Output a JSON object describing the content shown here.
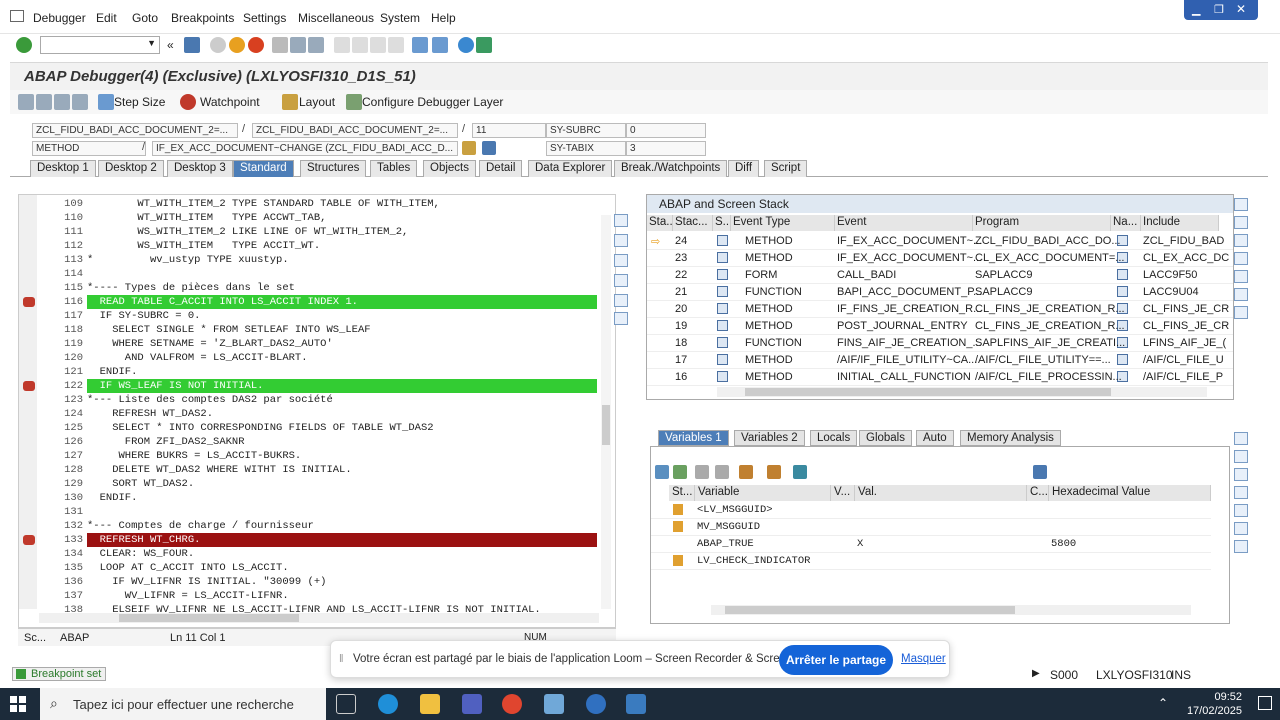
{
  "menubar": {
    "items": [
      "Debugger",
      "Edit",
      "Goto",
      "Breakpoints",
      "Settings",
      "Miscellaneous",
      "System",
      "Help"
    ]
  },
  "window": {
    "title": "ABAP Debugger(4)  (Exclusive) (LXLYOSFI310_D1S_51)"
  },
  "app_toolbar": {
    "step_size": "Step Size",
    "watchpoint": "Watchpoint",
    "layout": "Layout",
    "configure_layer": "Configure Debugger Layer"
  },
  "fields": {
    "program": "ZCL_FIDU_BADI_ACC_DOCUMENT_2=...",
    "include": "ZCL_FIDU_BADI_ACC_DOCUMENT_2=...",
    "line": "11",
    "sy_subrc_label": "SY-SUBRC",
    "sy_subrc_value": "0",
    "event_type": "METHOD",
    "event": "IF_EX_ACC_DOCUMENT~CHANGE (ZCL_FIDU_BADI_ACC_D...",
    "sy_tabix_label": "SY-TABIX",
    "sy_tabix_value": "3"
  },
  "tabs": [
    "Desktop 1",
    "Desktop 2",
    "Desktop 3",
    "Standard",
    "Structures",
    "Tables",
    "Objects",
    "Detail",
    "Data Explorer",
    "Break./Watchpoints",
    "Diff",
    "Script"
  ],
  "active_tab": "Standard",
  "code": [
    {
      "n": "109",
      "t": "        WT_WITH_ITEM_2 TYPE STANDARD TABLE OF WITH_ITEM,",
      "hl": ""
    },
    {
      "n": "110",
      "t": "        WT_WITH_ITEM   TYPE ACCWT_TAB,",
      "hl": ""
    },
    {
      "n": "111",
      "t": "        WS_WITH_ITEM_2 LIKE LINE OF WT_WITH_ITEM_2,",
      "hl": ""
    },
    {
      "n": "112",
      "t": "        WS_WITH_ITEM   TYPE ACCIT_WT.",
      "hl": ""
    },
    {
      "n": "113",
      "t": "*         wv_ustyp TYPE xuustyp.",
      "hl": ""
    },
    {
      "n": "114",
      "t": "",
      "hl": ""
    },
    {
      "n": "115",
      "t": "*---- Types de pièces dans le set",
      "hl": ""
    },
    {
      "n": "116",
      "t": "  READ TABLE C_ACCIT INTO LS_ACCIT INDEX 1.",
      "hl": "green"
    },
    {
      "n": "117",
      "t": "  IF SY-SUBRC = 0.",
      "hl": ""
    },
    {
      "n": "118",
      "t": "    SELECT SINGLE * FROM SETLEAF INTO WS_LEAF",
      "hl": ""
    },
    {
      "n": "119",
      "t": "    WHERE SETNAME = 'Z_BLART_DAS2_AUTO'",
      "hl": ""
    },
    {
      "n": "120",
      "t": "      AND VALFROM = LS_ACCIT-BLART.",
      "hl": ""
    },
    {
      "n": "121",
      "t": "  ENDIF.",
      "hl": ""
    },
    {
      "n": "122",
      "t": "  IF WS_LEAF IS NOT INITIAL.",
      "hl": "green"
    },
    {
      "n": "123",
      "t": "*--- Liste des comptes DAS2 par société",
      "hl": ""
    },
    {
      "n": "124",
      "t": "    REFRESH WT_DAS2.",
      "hl": ""
    },
    {
      "n": "125",
      "t": "    SELECT * INTO CORRESPONDING FIELDS OF TABLE WT_DAS2",
      "hl": ""
    },
    {
      "n": "126",
      "t": "      FROM ZFI_DAS2_SAKNR",
      "hl": ""
    },
    {
      "n": "127",
      "t": "     WHERE BUKRS = LS_ACCIT-BUKRS.",
      "hl": ""
    },
    {
      "n": "128",
      "t": "    DELETE WT_DAS2 WHERE WITHT IS INITIAL.",
      "hl": ""
    },
    {
      "n": "129",
      "t": "    SORT WT_DAS2.",
      "hl": ""
    },
    {
      "n": "130",
      "t": "  ENDIF.",
      "hl": ""
    },
    {
      "n": "131",
      "t": "",
      "hl": ""
    },
    {
      "n": "132",
      "t": "*--- Comptes de charge / fournisseur",
      "hl": ""
    },
    {
      "n": "133",
      "t": "  REFRESH WT_CHRG.",
      "hl": "red"
    },
    {
      "n": "134",
      "t": "  CLEAR: WS_FOUR.",
      "hl": ""
    },
    {
      "n": "135",
      "t": "  LOOP AT C_ACCIT INTO LS_ACCIT.",
      "hl": ""
    },
    {
      "n": "136",
      "t": "    IF WV_LIFNR IS INITIAL. \"30099 (+)",
      "hl": ""
    },
    {
      "n": "137",
      "t": "      WV_LIFNR = LS_ACCIT-LIFNR.",
      "hl": ""
    },
    {
      "n": "138",
      "t": "    ELSEIF WV_LIFNR NE LS_ACCIT-LIFNR AND LS_ACCIT-LIFNR IS NOT INITIAL.",
      "hl": ""
    }
  ],
  "editor_status": {
    "sc": "Sc...",
    "lang": "ABAP",
    "pos": "Ln 11 Col  1",
    "num": "NUM"
  },
  "stack": {
    "title": "ABAP and Screen Stack",
    "headers": [
      "Sta...",
      "Stac...",
      "S...",
      "Event Type",
      "Event",
      "Program",
      "Na...",
      "Include"
    ],
    "rows": [
      {
        "level": "24",
        "type": "METHOD",
        "event": "IF_EX_ACC_DOCUMENT~...",
        "program": "ZCL_FIDU_BADI_ACC_DO...",
        "include": "ZCL_FIDU_BAD",
        "current": true
      },
      {
        "level": "23",
        "type": "METHOD",
        "event": "IF_EX_ACC_DOCUMENT~...",
        "program": "CL_EX_ACC_DOCUMENT=...",
        "include": "CL_EX_ACC_DC",
        "current": false
      },
      {
        "level": "22",
        "type": "FORM",
        "event": "CALL_BADI",
        "program": "SAPLACC9",
        "include": "LACC9F50",
        "current": false
      },
      {
        "level": "21",
        "type": "FUNCTION",
        "event": "BAPI_ACC_DOCUMENT_P...",
        "program": "SAPLACC9",
        "include": "LACC9U04",
        "current": false
      },
      {
        "level": "20",
        "type": "METHOD",
        "event": "IF_FINS_JE_CREATION_R...",
        "program": "CL_FINS_JE_CREATION_R...",
        "include": "CL_FINS_JE_CR",
        "current": false
      },
      {
        "level": "19",
        "type": "METHOD",
        "event": "POST_JOURNAL_ENTRY",
        "program": "CL_FINS_JE_CREATION_R...",
        "include": "CL_FINS_JE_CR",
        "current": false
      },
      {
        "level": "18",
        "type": "FUNCTION",
        "event": "FINS_AIF_JE_CREATION_...",
        "program": "SAPLFINS_AIF_JE_CREATI...",
        "include": "LFINS_AIF_JE_(",
        "current": false
      },
      {
        "level": "17",
        "type": "METHOD",
        "event": "/AIF/IF_FILE_UTILITY~CA...",
        "program": "/AIF/CL_FILE_UTILITY==...",
        "include": "/AIF/CL_FILE_U",
        "current": false
      },
      {
        "level": "16",
        "type": "METHOD",
        "event": "INITIAL_CALL_FUNCTION",
        "program": "/AIF/CL_FILE_PROCESSIN...",
        "include": "/AIF/CL_FILE_P",
        "current": false
      }
    ]
  },
  "var_tabs": [
    "Variables 1",
    "Variables 2",
    "Locals",
    "Globals",
    "Auto",
    "Memory Analysis"
  ],
  "variables": {
    "headers": [
      "St...",
      "Variable",
      "V...",
      "Val.",
      "C...",
      "Hexadecimal Value"
    ],
    "rows": [
      {
        "name": "<LV_MSGGUID>",
        "val": "",
        "hex": ""
      },
      {
        "name": "MV_MSGGUID",
        "val": "",
        "hex": ""
      },
      {
        "name": "ABAP_TRUE",
        "val": "X",
        "hex": "5800"
      },
      {
        "name": "LV_CHECK_INDICATOR",
        "val": "",
        "hex": ""
      }
    ]
  },
  "status_bar": {
    "breakpoint": "Breakpoint set",
    "session": "S000",
    "system": "LXLYOSFI310",
    "mode": "INS"
  },
  "loom": {
    "text": "Votre écran est partagé par le biais de l'application Loom – Screen Recorder & Screen Capture.",
    "stop": "Arrêter le partage",
    "hide": "Masquer"
  },
  "taskbar": {
    "search": "Tapez ici pour effectuer une recherche",
    "time": "09:52",
    "date": "17/02/2025"
  },
  "colors": {
    "accent": "#4d7eb8",
    "highlight_green": "#33cc33",
    "highlight_red": "#9b1111",
    "loom_blue": "#1464d8"
  }
}
